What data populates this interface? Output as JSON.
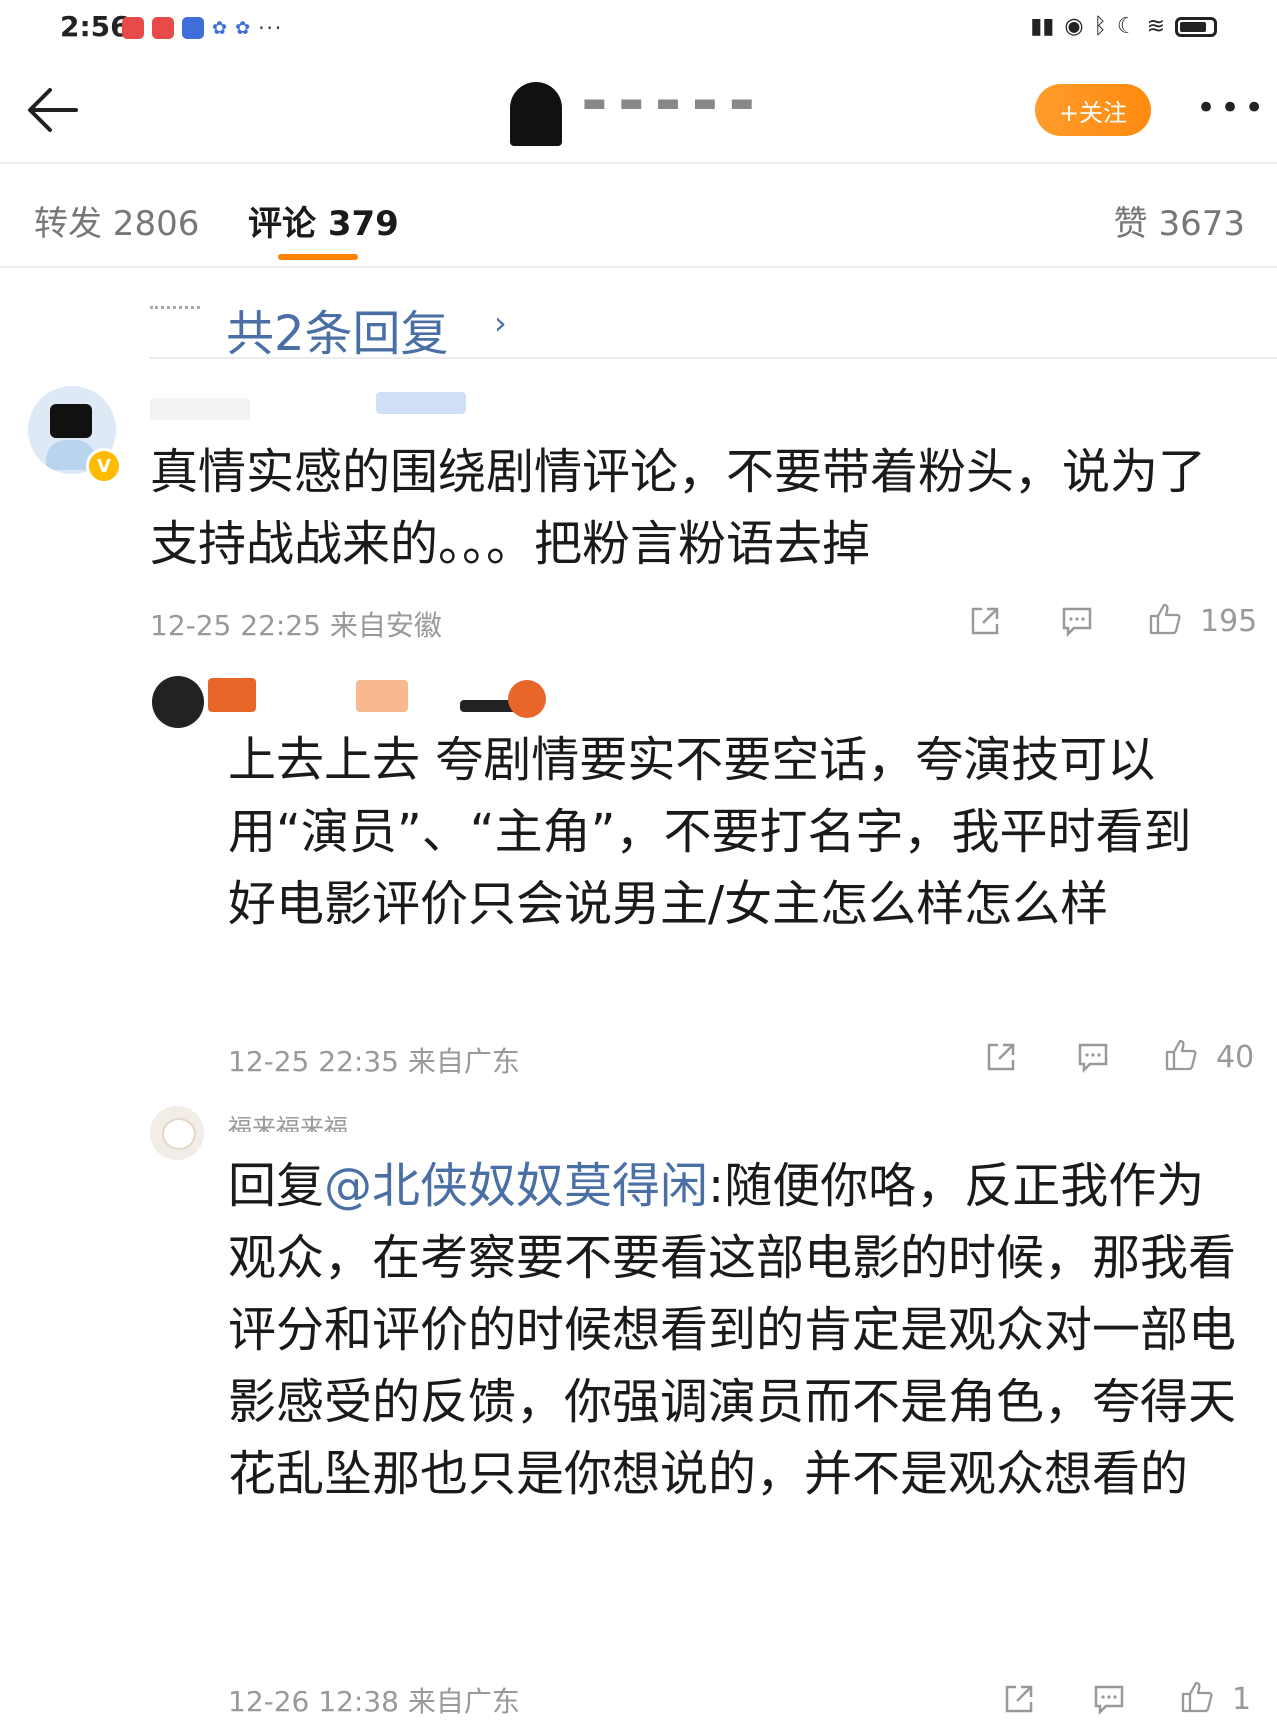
{
  "status_bar": {
    "time": "2:56",
    "more": "···"
  },
  "header": {
    "follow_label": "+关注",
    "more_label": "•••"
  },
  "tabs": [
    {
      "label": "转发 2806"
    },
    {
      "label": "评论 379"
    },
    {
      "label": "赞 3673"
    }
  ],
  "reply_link": {
    "label": "共2条回复",
    "chevron": "›"
  },
  "comments": [
    {
      "text": "真情实感的围绕剧情评论，不要带着粉头，说为了支持战战来的。。。把粉言粉语去掉",
      "meta": "12-25 22:25 来自安徽",
      "likes": "195"
    },
    {
      "text": "上去上去 夸剧情要实不要空话，夸演技可以用“演员”、“主角”，不要打名字，我平时看到好电影评价只会说男主/女主怎么样怎么样",
      "meta": "12-25 22:35 来自广东",
      "likes": "40"
    },
    {
      "username": "福来福来福",
      "reply_prefix": "回复",
      "mention": "@北侠奴奴莫得闲",
      "text": ":随便你咯，反正我作为观众，在考察要不要看这部电影的时候，那我看评分和评价的时候想看到的肯定是观众对一部电影感受的反馈，你强调演员而不是角色，夸得天花乱坠那也只是你想说的，并不是观众想看的",
      "meta": "12-26 12:38 来自广东",
      "likes": "1"
    }
  ],
  "colors": {
    "accent_orange": "#ff8200",
    "link_blue": "#4a6fa5",
    "meta_gray": "#999999"
  }
}
